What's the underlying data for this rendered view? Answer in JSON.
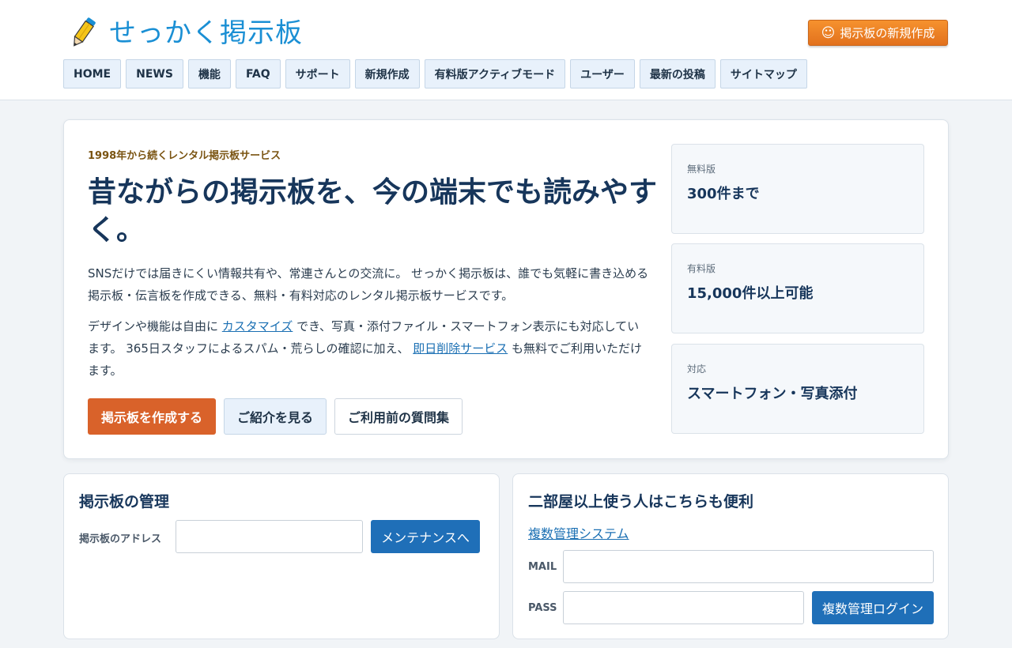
{
  "header": {
    "logo_text": "せっかく掲示板",
    "new_board_label": "掲示板の新規作成"
  },
  "nav": {
    "items": [
      {
        "label": "HOME"
      },
      {
        "label": "NEWS"
      },
      {
        "label": "機能"
      },
      {
        "label": "FAQ"
      },
      {
        "label": "サポート"
      },
      {
        "label": "新規作成"
      },
      {
        "label": "有料版アクティブモード"
      },
      {
        "label": "ユーザー"
      },
      {
        "label": "最新の投稿"
      },
      {
        "label": "サイトマップ"
      }
    ]
  },
  "hero": {
    "eyebrow": "1998年から続くレンタル掲示板サービス",
    "headline": "昔ながらの掲示板を、今の端末でも読みやすく。",
    "desc1": "SNSだけでは届きにくい情報共有や、常連さんとの交流に。 せっかく掲示板は、誰でも気軽に書き込める掲示板・伝言板を作成できる、無料・有料対応のレンタル掲示板サービスです。",
    "desc2_part1": "デザインや機能は自由に ",
    "desc2_link1": "カスタマイズ",
    "desc2_part2": " でき、写真・添付ファイル・スマートフォン表示にも対応しています。 365日スタッフによるスパム・荒らしの確認に加え、 ",
    "desc2_link2": "即日削除サービス",
    "desc2_part3": " も無料でご利用いただけます。",
    "cta_primary": "掲示板を作成する",
    "cta_secondary": "ご紹介を見る",
    "cta_outline": "ご利用前の質問集",
    "stats": [
      {
        "label": "無料版",
        "value": "300件まで"
      },
      {
        "label": "有料版",
        "value": "15,000件以上可能"
      },
      {
        "label": "対応",
        "value": "スマートフォン・写真添付"
      }
    ]
  },
  "manage": {
    "title": "掲示板の管理",
    "address_label": "掲示板のアドレス",
    "address_value": "",
    "maintenance_button": "メンテナンスへ"
  },
  "multi": {
    "title": "二部屋以上使う人はこちらも便利",
    "link": "複数管理システム",
    "mail_label": "MAIL",
    "mail_value": "",
    "pass_label": "PASS",
    "pass_value": "",
    "login_button": "複数管理ログイン"
  },
  "colors": {
    "accent_orange": "#e2711d",
    "primary_blue": "#1f6fb8",
    "logo_blue": "#1a8fd4",
    "cta_orange": "#d9622a"
  }
}
